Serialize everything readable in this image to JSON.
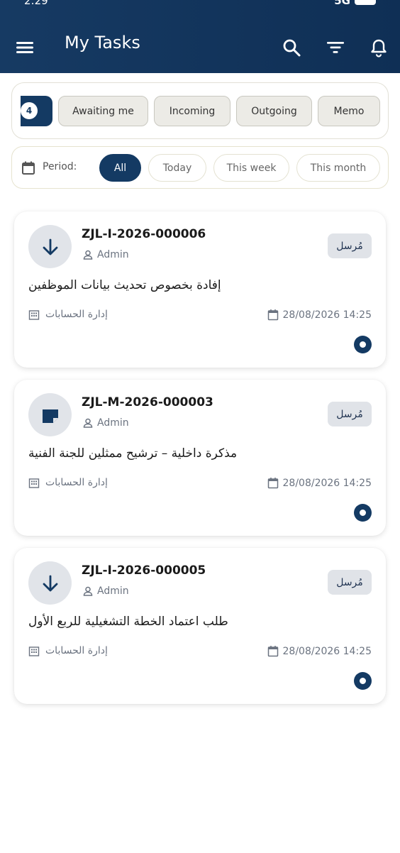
{
  "status_bar": {
    "time": "2:29",
    "signal": "5G"
  },
  "header": {
    "title": "My Tasks"
  },
  "tabs": {
    "active_count": "4",
    "items": [
      {
        "label": "Awaiting me"
      },
      {
        "label": "Incoming"
      },
      {
        "label": "Outgoing"
      },
      {
        "label": "Memo"
      }
    ]
  },
  "period": {
    "label": "Period:",
    "options": [
      {
        "label": "All",
        "selected": true
      },
      {
        "label": "Today",
        "selected": false
      },
      {
        "label": "This week",
        "selected": false
      },
      {
        "label": "This month",
        "selected": false
      }
    ]
  },
  "tasks": [
    {
      "ref": "ZJL-I-2026-000006",
      "user": "Admin",
      "status": "مُرسل",
      "subject": "إفادة بخصوص تحديث بيانات الموظفين",
      "department": "إدارة الحسابات",
      "datetime": "28/08/2026 14:25",
      "icon": "arrow-down-icon"
    },
    {
      "ref": "ZJL-M-2026-000003",
      "user": "Admin",
      "status": "مُرسل",
      "subject": "مذكرة داخلية – ترشيح ممثلين للجنة الفنية",
      "department": "إدارة الحسابات",
      "datetime": "28/08/2026 14:25",
      "icon": "note-icon"
    },
    {
      "ref": "ZJL-I-2026-000005",
      "user": "Admin",
      "status": "مُرسل",
      "subject": "طلب اعتماد الخطة التشغيلية للربع الأول",
      "department": "إدارة الحسابات",
      "datetime": "28/08/2026 14:25",
      "icon": "arrow-down-icon"
    }
  ],
  "colors": {
    "primary": "#143a63",
    "chip_border": "#e4e2d2",
    "tab_bg": "#ecebe6"
  }
}
